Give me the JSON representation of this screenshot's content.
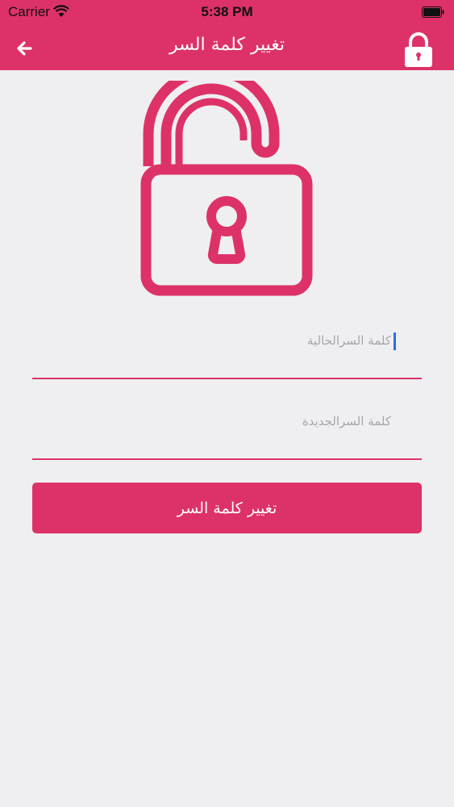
{
  "status_bar": {
    "carrier": "Carrier",
    "time": "5:38 PM",
    "icons": [
      "wifi-icon",
      "battery-icon"
    ]
  },
  "nav": {
    "title": "تغيير كلمة السر",
    "back_icon": "arrow-left-icon",
    "lock_icon": "lock-closed-icon"
  },
  "hero": {
    "icon": "lock-open-icon"
  },
  "form": {
    "current_password": {
      "value": "",
      "placeholder": "كلمة السرالحالية"
    },
    "new_password": {
      "value": "",
      "placeholder": "كلمة السرالجديدة"
    },
    "submit_label": "تغيير كلمة السر"
  },
  "colors": {
    "accent": "#dd3268",
    "background": "#efeff1",
    "caret": "#2f6de5"
  }
}
